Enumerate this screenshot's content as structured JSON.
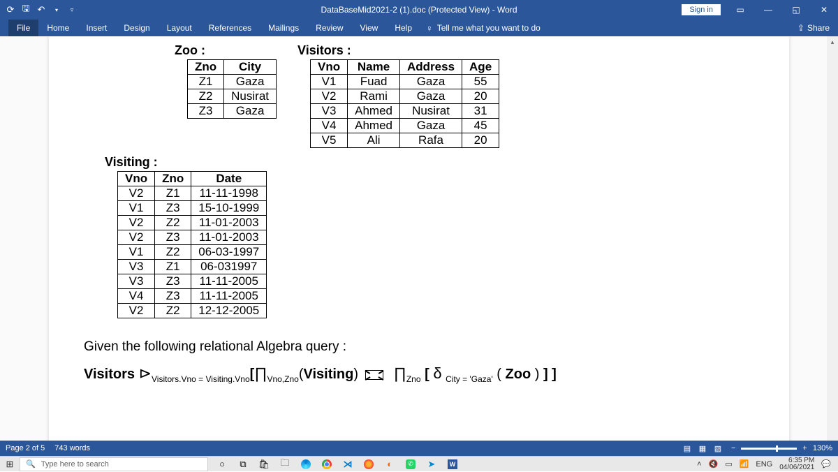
{
  "titlebar": {
    "title": "DataBaseMid2021-2 (1).doc (Protected View) - Word",
    "signin": "Sign in"
  },
  "ribbon": {
    "tabs": [
      "File",
      "Home",
      "Insert",
      "Design",
      "Layout",
      "References",
      "Mailings",
      "Review",
      "View",
      "Help"
    ],
    "tellme": "Tell me what you want to do",
    "share": "Share"
  },
  "doc": {
    "zoo": {
      "title": "Zoo :",
      "headers": [
        "Zno",
        "City"
      ],
      "rows": [
        [
          "Z1",
          "Gaza"
        ],
        [
          "Z2",
          "Nusirat"
        ],
        [
          "Z3",
          "Gaza"
        ]
      ]
    },
    "visitors": {
      "title": "Visitors :",
      "headers": [
        "Vno",
        "Name",
        "Address",
        "Age"
      ],
      "rows": [
        [
          "V1",
          "Fuad",
          "Gaza",
          "55"
        ],
        [
          "V2",
          "Rami",
          "Gaza",
          "20"
        ],
        [
          "V3",
          "Ahmed",
          "Nusirat",
          "31"
        ],
        [
          "V4",
          "Ahmed",
          "Gaza",
          "45"
        ],
        [
          "V5",
          "Ali",
          "Rafa",
          "20"
        ]
      ]
    },
    "visiting": {
      "title": "Visiting :",
      "headers": [
        "Vno",
        "Zno",
        "Date"
      ],
      "rows": [
        [
          "V2",
          "Z1",
          "11-11-1998"
        ],
        [
          "V1",
          "Z3",
          "15-10-1999"
        ],
        [
          "V2",
          "Z2",
          "11-01-2003"
        ],
        [
          "V2",
          "Z3",
          "11-01-2003"
        ],
        [
          "V1",
          "Z2",
          "06-03-1997"
        ],
        [
          "V3",
          "Z1",
          "06-031997"
        ],
        [
          "V3",
          "Z3",
          "11-11-2005"
        ],
        [
          "V4",
          "Z3",
          "11-11-2005"
        ],
        [
          "V2",
          "Z2",
          "12-12-2005"
        ]
      ]
    },
    "prose": "Given the following relational Algebra query :",
    "alg": {
      "v": "Visitors",
      "sel": "⊳",
      "cond1": "Visitors.Vno = Visiting.Vno",
      "proj": "∏",
      "projattrs": "Vno,Zno",
      "ving": "Visiting",
      "join": "⋈",
      "proj2attrs": "Zno",
      "sigma": "δ",
      "cond2": "City = 'Gaza'",
      "zoo": "Zoo"
    }
  },
  "status": {
    "page": "Page 2 of 5",
    "words": "743 words",
    "zoom": "130%"
  },
  "taskbar": {
    "search": "Type here to search",
    "lang": "ENG",
    "time": "6:35 PM",
    "date": "04/06/2021"
  }
}
